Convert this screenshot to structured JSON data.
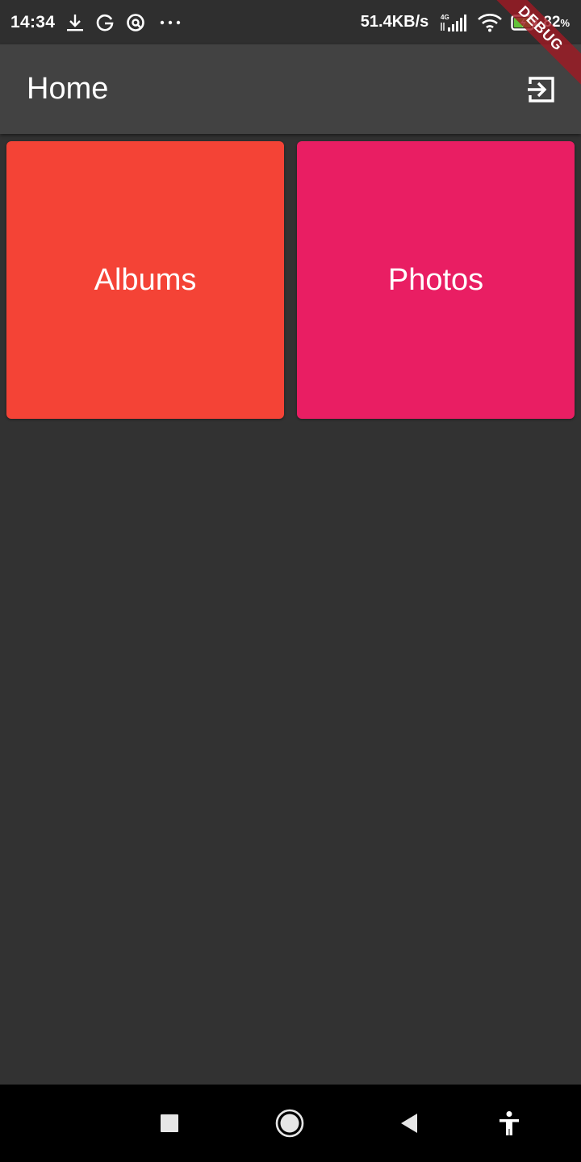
{
  "status_bar": {
    "time": "14:34",
    "icons_left": [
      "download-icon",
      "g-icon",
      "q-icon",
      "more-dots-icon"
    ],
    "net_speed": "51.4KB/s",
    "signal_label": "4G",
    "battery_percent": "82",
    "battery_unit": "%"
  },
  "debug_banner": "DEBUG",
  "app_bar": {
    "title": "Home",
    "action_icon": "logout-icon"
  },
  "tiles": [
    {
      "label": "Albums",
      "color": "#f44336"
    },
    {
      "label": "Photos",
      "color": "#e91e63"
    }
  ],
  "colors": {
    "background": "#323232",
    "app_bar": "#424242",
    "nav_bar": "#000000"
  },
  "nav_bar": {
    "icons": [
      "recents-square-icon",
      "home-circle-icon",
      "back-triangle-icon",
      "accessibility-icon"
    ]
  }
}
